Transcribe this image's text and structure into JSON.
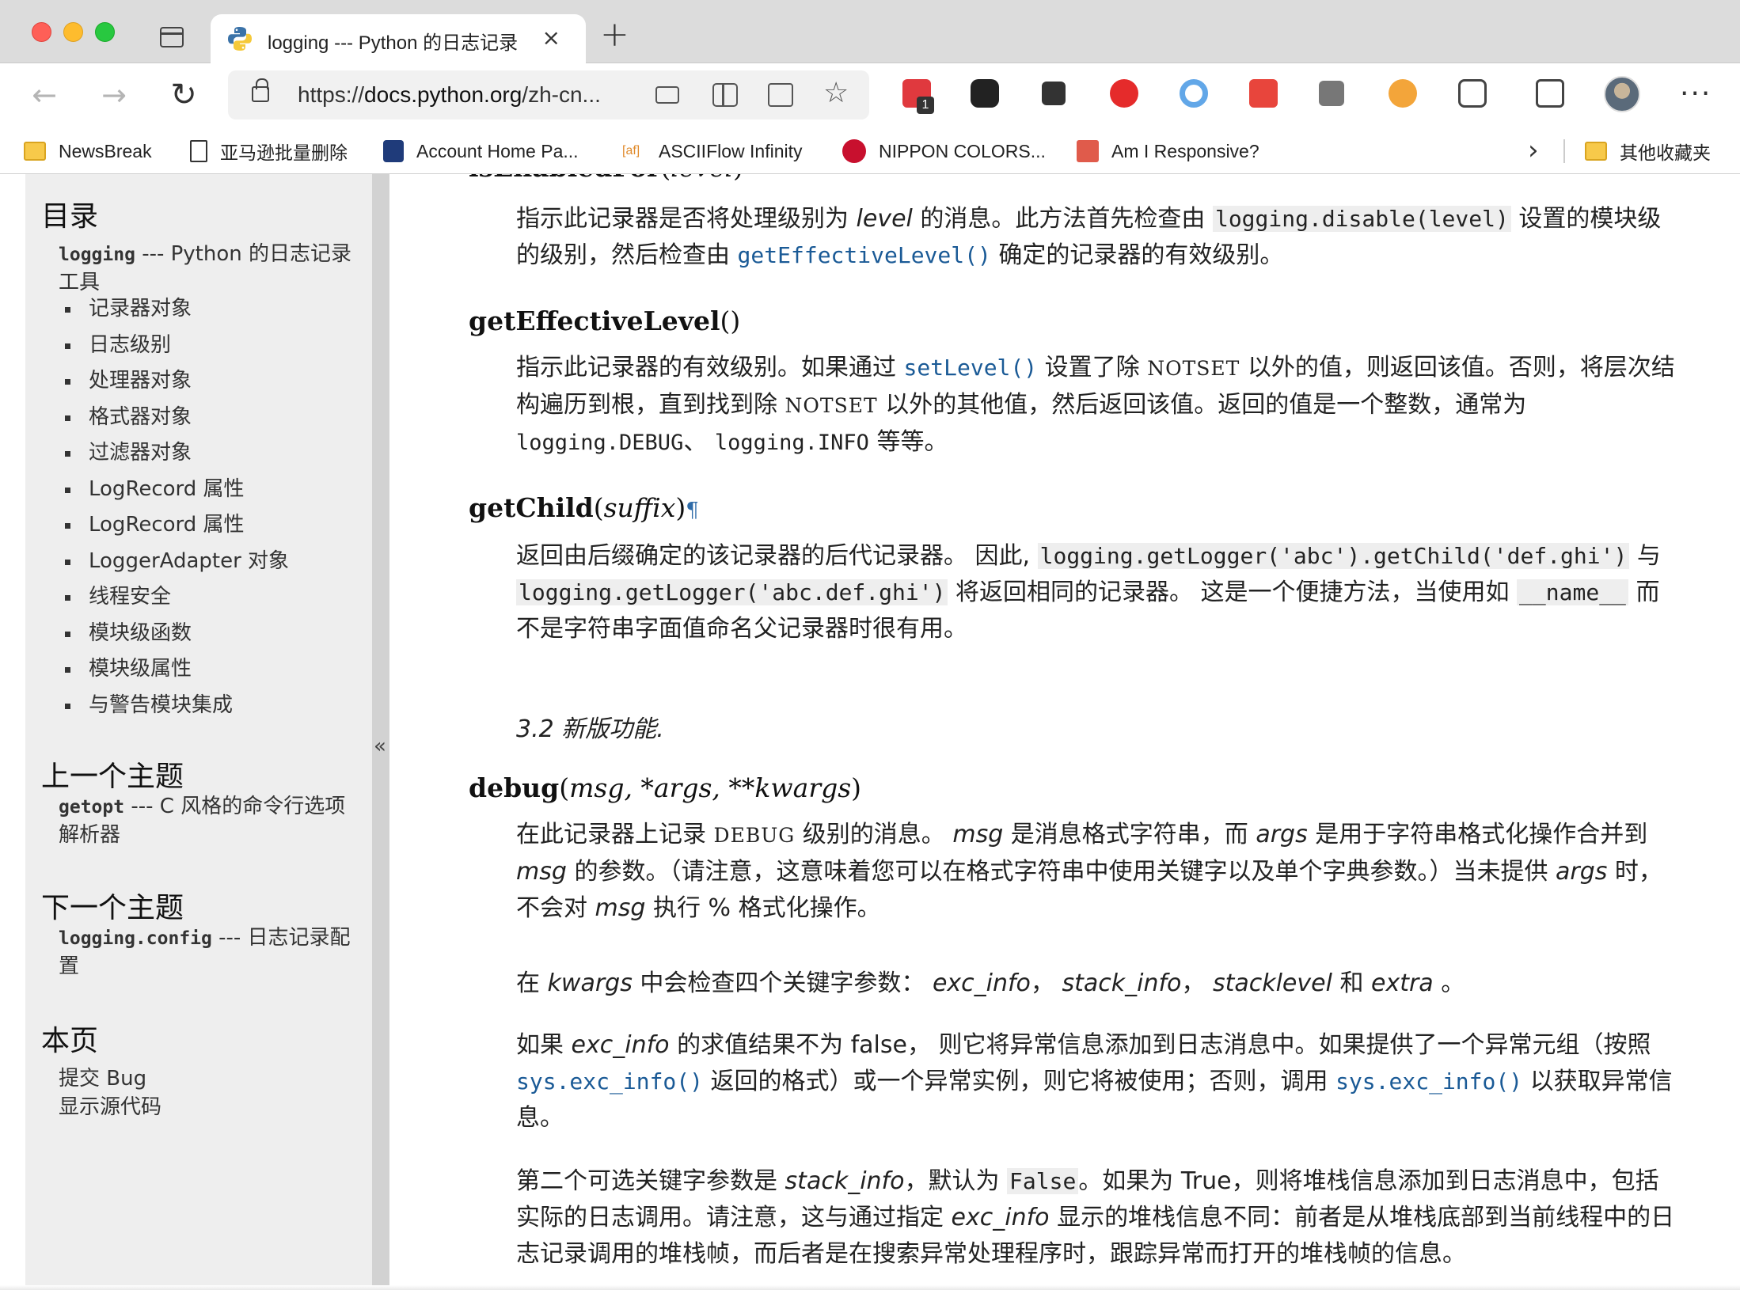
{
  "browser": {
    "tab": {
      "title": "logging --- Python 的日志记录",
      "close": "×",
      "favicon": "python-logo"
    },
    "new_tab": "+",
    "url_scheme": "https://",
    "url_host": "docs.python.org",
    "url_path": "/zh-cn...",
    "extension_badge": "1",
    "more": "···",
    "bookmarks": [
      {
        "label": "NewsBreak",
        "icon": "folder-icon"
      },
      {
        "label": "亚马逊批量删除",
        "icon": "page-icon"
      },
      {
        "label": "Account Home Pa...",
        "icon": "app-icon"
      },
      {
        "label": "ASCIIFlow Infinity",
        "icon": "asciiflow-icon"
      },
      {
        "label": "NIPPON COLORS...",
        "icon": "red-circle-icon"
      },
      {
        "label": "Am I Responsive?",
        "icon": "red-square-icon"
      }
    ],
    "other_bookmarks": "其他收藏夹"
  },
  "sidebar": {
    "toc_title": "目录",
    "toc_module_code": "logging",
    "toc_module_text": " --- Python 的日志记录工具",
    "toc_items": [
      "记录器对象",
      "日志级别",
      "处理器对象",
      "格式器对象",
      "过滤器对象",
      "LogRecord 属性",
      "LogRecord 属性",
      "LoggerAdapter 对象",
      "线程安全",
      "模块级函数",
      "模块级属性",
      "与警告模块集成"
    ],
    "prev_title": "上一个主题",
    "prev_code": "getopt",
    "prev_text": " --- C 风格的命令行选项解析器",
    "next_title": "下一个主题",
    "next_code": "logging.config",
    "next_text": " --- 日志记录配置",
    "this_page_title": "本页",
    "report_bug": "提交 Bug",
    "show_source": "显示源代码",
    "collapse": "«"
  },
  "content": {
    "isenabled": {
      "name": "isEnabledFor",
      "param": "level",
      "p1": "指示此记录器是否将处理级别为 ",
      "p1_em": "level",
      "p1b": " 的消息。此方法首先检查由 ",
      "p1_code": "logging.disable(level)",
      "p1c": " 设置的模块级的级别，然后检查由 ",
      "p1_xref": "getEffectiveLevel()",
      "p1d": " 确定的记录器的有效级别。"
    },
    "geteffective": {
      "name": "getEffectiveLevel",
      "parens": "()",
      "p1": "指示此记录器的有效级别。如果通过 ",
      "p1_xref": "setLevel()",
      "p1b": " 设置了除 ",
      "p1_sc": "NOTSET",
      "p1c": " 以外的值，则返回该值。否则，将层次结构遍历到根，直到找到除 ",
      "p1_sc2": "NOTSET",
      "p1d": " 以外的其他值，然后返回该值。返回的值是一个整数，通常为 ",
      "p1_code1": "logging.DEBUG",
      "p1e": "、 ",
      "p1_code2": "logging.INFO",
      "p1f": " 等等。"
    },
    "getchild": {
      "name": "getChild",
      "param": "suffix",
      "pilcrow": "¶",
      "p1": "返回由后缀确定的该记录器的后代记录器。 因此, ",
      "p1_code1": "logging.getLogger('abc').getChild('def.ghi')",
      "p1b": " 与 ",
      "p1_code2": "logging.getLogger('abc.def.ghi')",
      "p1c": " 将返回相同的记录器。 这是一个便捷方法，当使用如 ",
      "p1_code3": "__name__",
      "p1d": " 而不是字符串字面值命名父记录器时很有用。",
      "version": "3.2 新版功能."
    },
    "debug": {
      "name": "debug",
      "params": "msg, *args, **kwargs",
      "p1a": "在此记录器上记录 ",
      "p1_sc": "DEBUG",
      "p1b": " 级别的消息。 ",
      "p1_em1": "msg",
      "p1c": " 是消息格式字符串，而 ",
      "p1_em2": "args",
      "p1d": " 是用于字符串格式化操作合并到 ",
      "p1_em3": "msg",
      "p1e": " 的参数。（请注意，这意味着您可以在格式字符串中使用关键字以及单个字典参数。）当未提供 ",
      "p1_em4": "args",
      "p1f": " 时，不会对 ",
      "p1_em5": "msg",
      "p1g": " 执行 % 格式化操作。",
      "p2a": "在 ",
      "p2_em1": "kwargs",
      "p2b": " 中会检查四个关键字参数： ",
      "p2_em2": "exc_info",
      "p2c": "， ",
      "p2_em3": "stack_info",
      "p2d": "， ",
      "p2_em4": "stacklevel",
      "p2e": " 和 ",
      "p2_em5": "extra",
      "p2f": " 。",
      "p3a": "如果 ",
      "p3_em1": "exc_info",
      "p3b": " 的求值结果不为 false， 则它将异常信息添加到日志消息中。如果提供了一个异常元组（按照 ",
      "p3_xref1": "sys.exc_info()",
      "p3c": " 返回的格式）或一个异常实例，则它将被使用；否则，调用 ",
      "p3_xref2": "sys.exc_info()",
      "p3d": " 以获取异常信息。",
      "p4a": "第二个可选关键字参数是 ",
      "p4_em1": "stack_info",
      "p4b": "，默认为 ",
      "p4_code": "False",
      "p4c": "。如果为 True，则将堆栈信息添加到日志消息中，包括实际的日志调用。请注意，这与通过指定 ",
      "p4_em2": "exc_info",
      "p4d": " 显示的堆栈信息不同：前者是从堆栈底部到当前线程中的日志记录调用的堆栈帧，而后者是在搜索异常处理程序时，跟踪异常而打开的堆栈帧的信息。"
    }
  }
}
